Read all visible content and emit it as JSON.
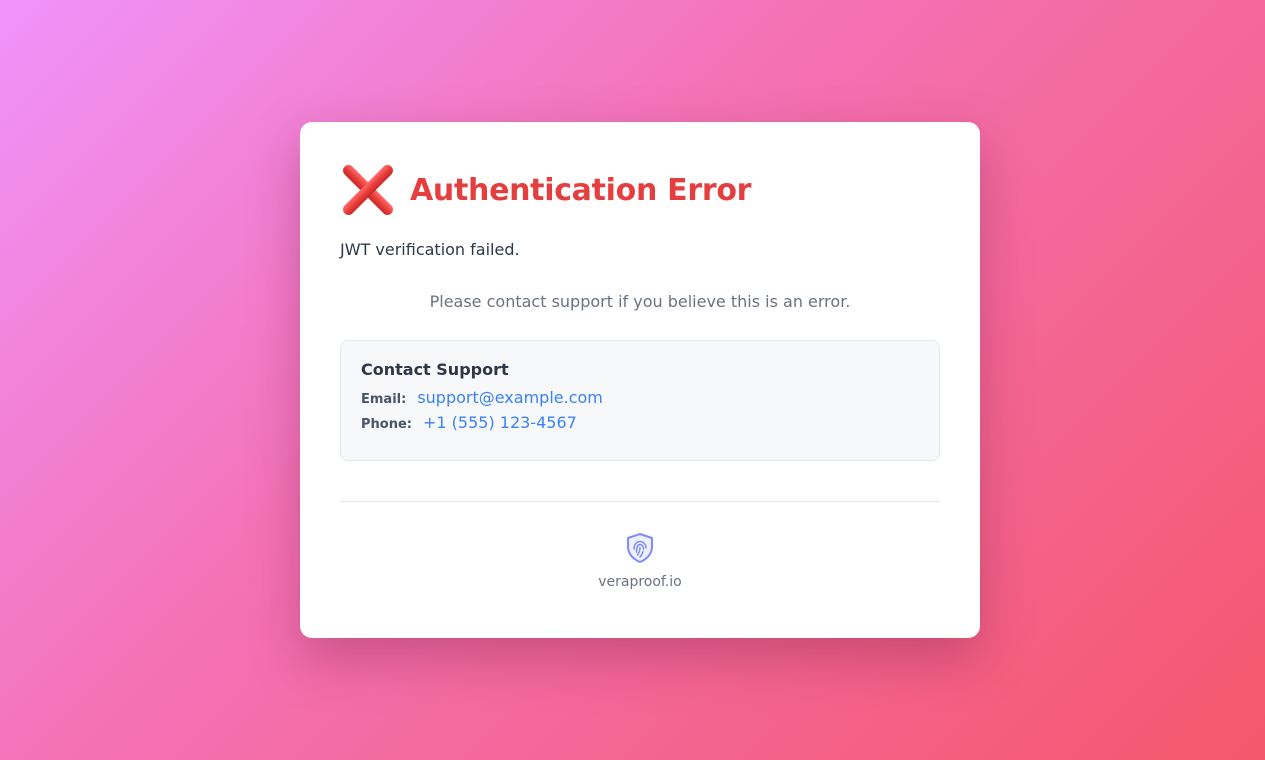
{
  "error": {
    "title": "Authentication Error",
    "icon": "cross-mark-icon",
    "message": "JWT verification failed.",
    "help_text": "Please contact support if you believe this is an error."
  },
  "contact": {
    "title": "Contact Support",
    "email_label": "Email:",
    "email": "support@example.com",
    "phone_label": "Phone:",
    "phone": "+1 (555) 123-4567"
  },
  "footer": {
    "logo_icon": "shield-fingerprint-icon",
    "domain": "veraproof.io"
  },
  "colors": {
    "error": "#e53e3e",
    "link": "#3b82f6",
    "logo": "#818cf8"
  }
}
